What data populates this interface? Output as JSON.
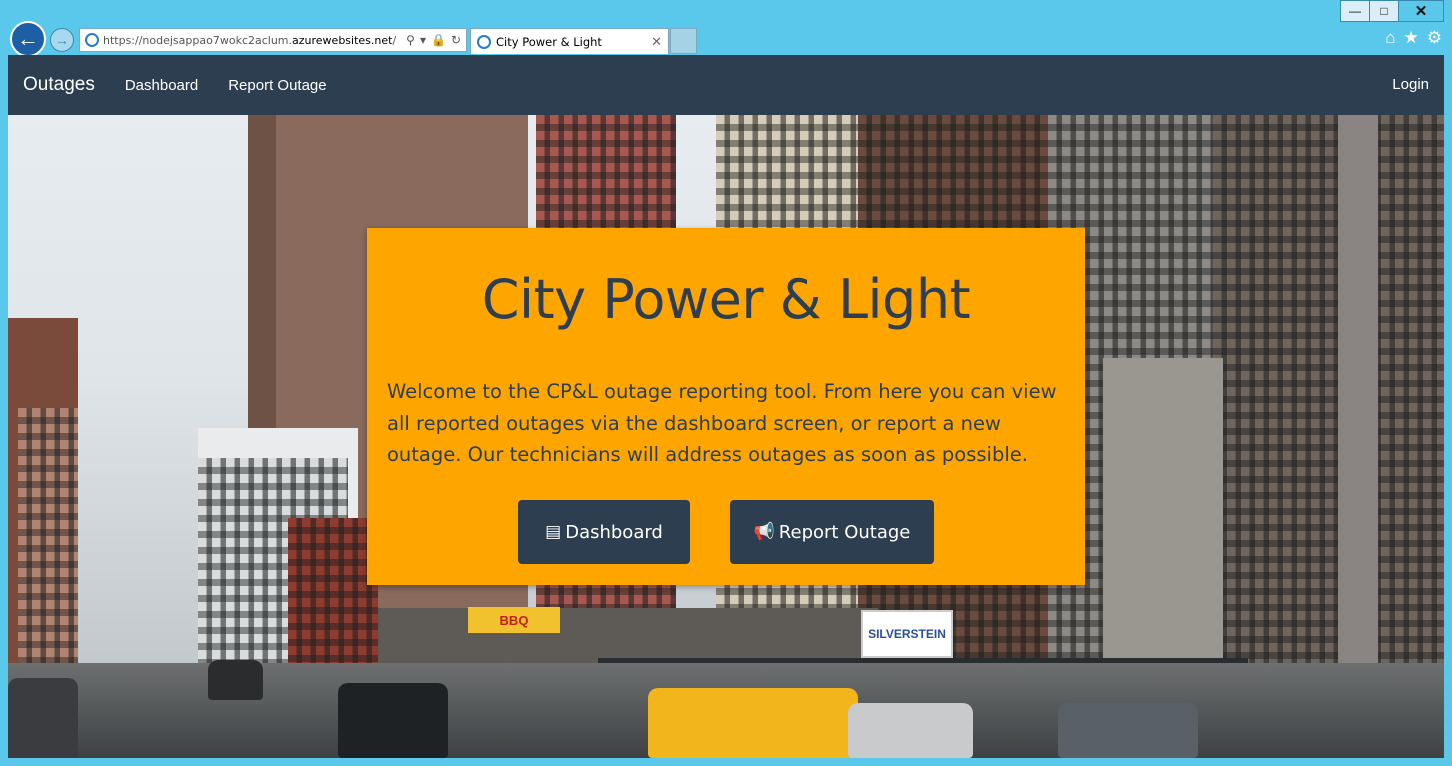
{
  "browser": {
    "url_prefix": "https://nodejsappao7wokc2aclum.",
    "url_domain": "azurewebsites.net",
    "url_suffix": "/",
    "tab_title": "City Power & Light",
    "window_controls": [
      "minimize-icon",
      "maximize-icon",
      "close-icon"
    ],
    "toolbar_icons": [
      "home-icon",
      "star-icon",
      "gear-icon"
    ]
  },
  "navbar": {
    "brand": "Outages",
    "links": [
      "Dashboard",
      "Report Outage"
    ],
    "login": "Login"
  },
  "scene": {
    "signs": [
      "BBQ",
      "SILVERSTEIN"
    ]
  },
  "hero": {
    "title": "City Power & Light",
    "text": "Welcome to the CP&L outage reporting tool. From here you can view all reported outages via the dashboard screen, or report a new outage. Our technicians will address outages as soon as possible.",
    "buttons": [
      {
        "label": "Dashboard",
        "icon": "list-icon"
      },
      {
        "label": "Report Outage",
        "icon": "bullhorn-icon"
      }
    ]
  },
  "colors": {
    "navbar": "#2c3e50",
    "hero_bg": "#ffa500",
    "chrome": "#5ac8ea"
  }
}
